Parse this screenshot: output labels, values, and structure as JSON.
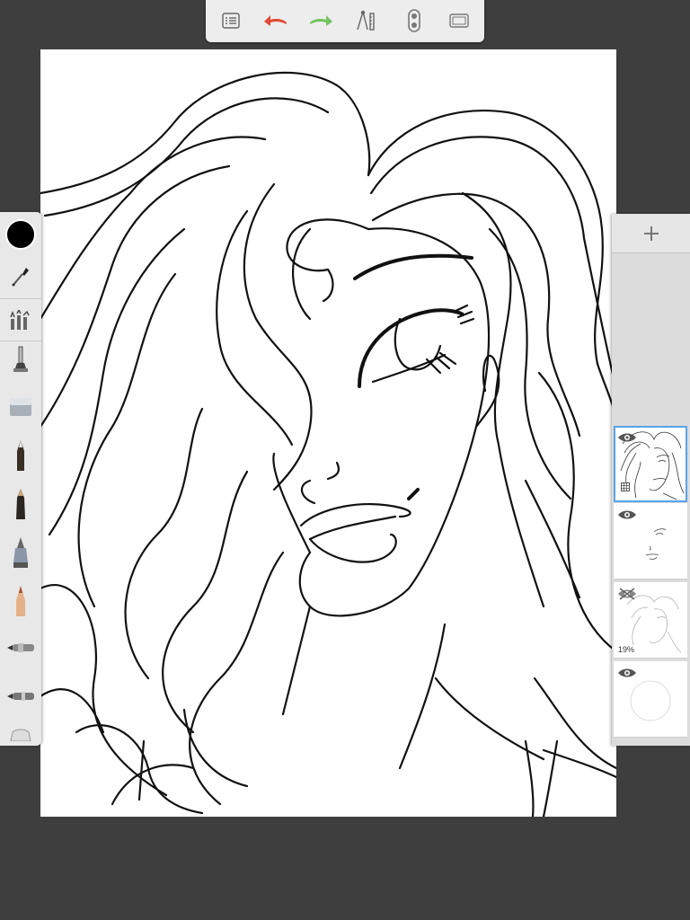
{
  "app": {
    "toolbar": {
      "icons": [
        "menu-list-icon",
        "undo-arrow-icon",
        "redo-arrow-icon",
        "ruler-compass-icon",
        "layers-toggle-icon",
        "fullscreen-icon"
      ],
      "colors": {
        "undo": "#e04a36",
        "redo": "#73c25e"
      }
    },
    "tools": {
      "current_color": "#000000",
      "items": [
        "color-puck",
        "eyedropper-tool",
        "brush-properties-tool",
        "airbrush-tool",
        "eraser-tool",
        "pencil-tool",
        "marker-tool",
        "chisel-pen-tool",
        "ballpoint-pen-tool",
        "paintbrush-tool",
        "airbrush-nozzle-tool",
        "smudge-tool"
      ]
    },
    "layers": {
      "add_icon": "plus-icon",
      "items": [
        {
          "name": "layer-1",
          "visible": true,
          "selected": true
        },
        {
          "name": "layer-2",
          "visible": true,
          "selected": false
        },
        {
          "name": "layer-3",
          "visible": false,
          "selected": false,
          "opacity_label": "19%"
        },
        {
          "name": "background-layer",
          "visible": true,
          "selected": false
        }
      ]
    }
  }
}
